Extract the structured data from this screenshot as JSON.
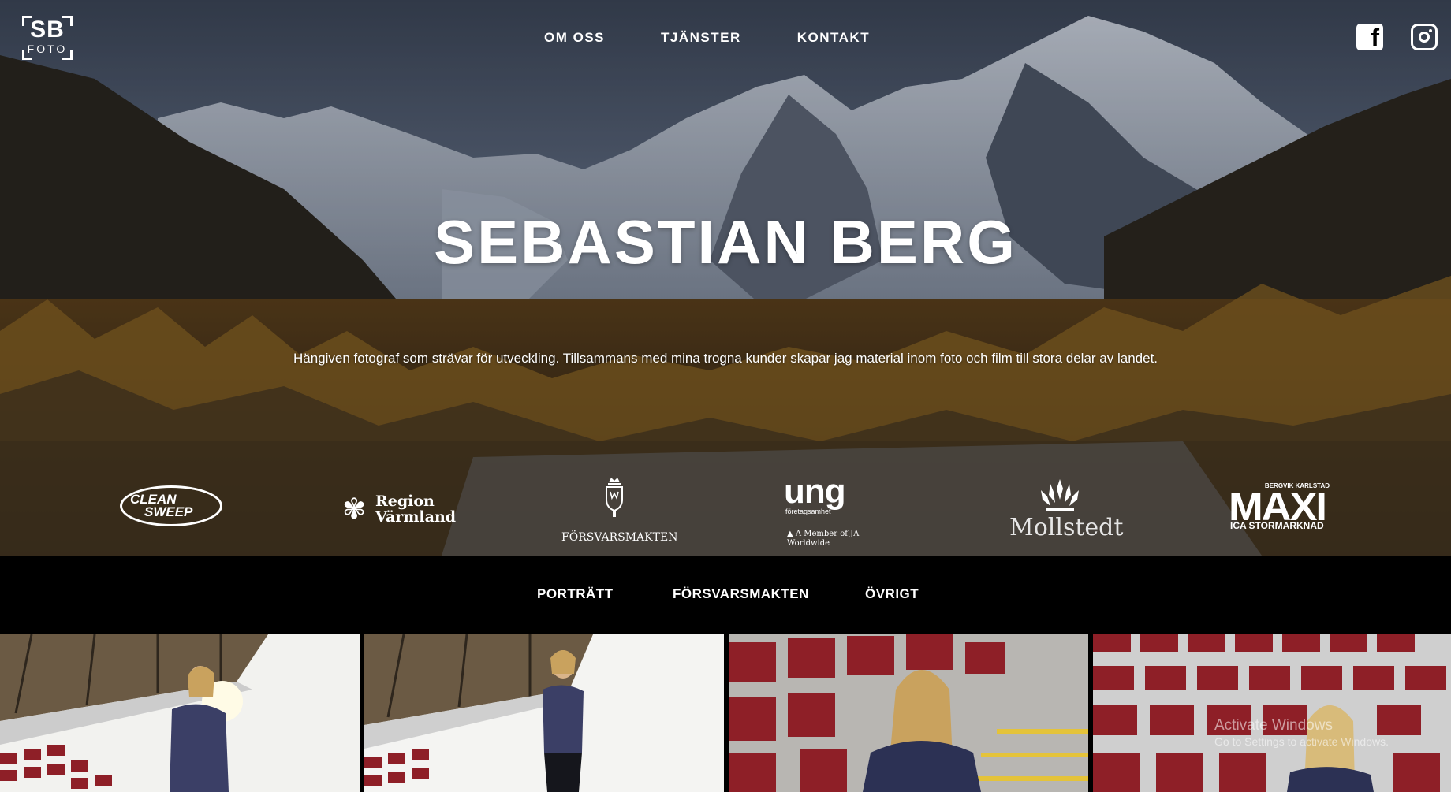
{
  "brand": {
    "logo_main": "SB",
    "logo_sub": "FOTO"
  },
  "nav": {
    "items": [
      "OM OSS",
      "TJÄNSTER",
      "KONTAKT"
    ]
  },
  "social": [
    {
      "name": "facebook",
      "icon": "facebook-icon",
      "glyph": "f"
    },
    {
      "name": "instagram",
      "icon": "instagram-icon"
    }
  ],
  "hero": {
    "title": "SEBASTIAN BERG",
    "subtitle": "Hängiven fotograf som strävar för utveckling. Tillsammans med mina trogna kunder skapar jag material inom foto och film till stora delar av landet."
  },
  "clients": {
    "clean_sweep": {
      "line1": "CLEAN",
      "line2": "SWEEP"
    },
    "region": {
      "glyph": "✾",
      "line1": "Region",
      "line2": "Värmland"
    },
    "forsvarsmakten": {
      "line1": "FÖRSVARSMAKTEN"
    },
    "ung": {
      "line1": "ung",
      "line2": "företagsamhet",
      "line3": "▲ A Member of JA Worldwide"
    },
    "mollstedt": {
      "line1": "Mollstedt"
    },
    "maxi": {
      "line1": "BERGVIK KARLSTAD",
      "line2": "MAXI",
      "line3": "ICA STORMARKNAD"
    }
  },
  "filters": {
    "items": [
      "PORTRÄTT",
      "FÖRSVARSMAKTEN",
      "ÖVRIGT"
    ]
  },
  "gallery": {
    "count": 4
  },
  "watermark": {
    "line1": "Activate Windows",
    "line2": "Go to Settings to activate Windows."
  },
  "colors": {
    "background": "#000000",
    "text": "#ffffff",
    "seat_red": "#8e1f27"
  }
}
